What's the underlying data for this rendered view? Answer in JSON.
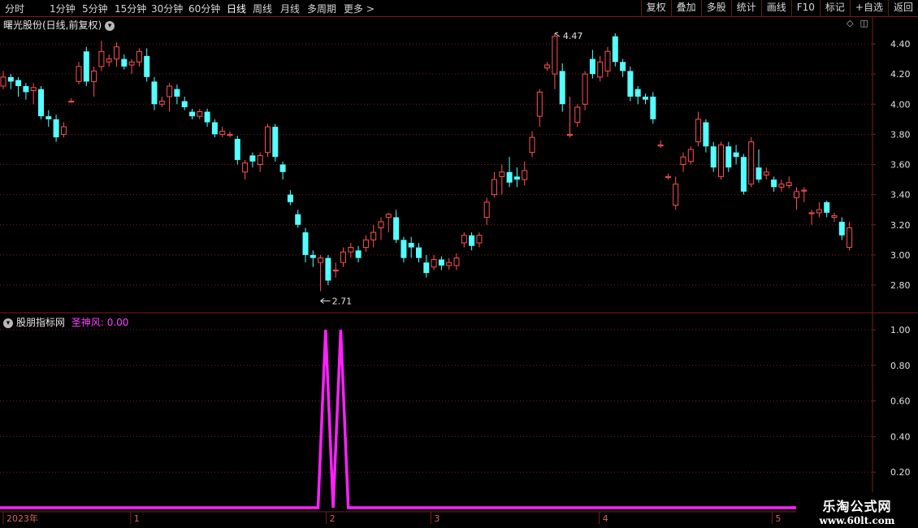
{
  "toolbar": {
    "periods": [
      "分时",
      "1分钟",
      "5分钟",
      "15分钟",
      "30分钟",
      "60分钟",
      "日线",
      "周线",
      "月线",
      "多周期",
      "更多 >"
    ],
    "active_period": "日线",
    "buttons": [
      "复权",
      "叠加",
      "多股",
      "统计",
      "画线",
      "F10",
      "标记",
      "+自选",
      "返回"
    ]
  },
  "main_panel": {
    "title": "曙光股份(日线,前复权)",
    "high_label": "4.47",
    "low_label": "2.71"
  },
  "indicator_panel": {
    "name": "股朋指标网",
    "series_label": "圣神风: 0.00"
  },
  "date_axis": [
    "2023年",
    "1",
    "2",
    "3",
    "4",
    "5"
  ],
  "watermark": {
    "line1": "乐淘公式网",
    "line2": "www.60lt.com"
  },
  "colors": {
    "up": "#ff5050",
    "down": "#54ffff",
    "indicator": "#ff20ff",
    "grid": "#7a1e1e"
  },
  "chart_data": [
    {
      "type": "candlestick",
      "title": "曙光股份(日线,前复权)",
      "ylim": [
        2.71,
        4.47
      ],
      "y_ticks": [
        4.4,
        4.2,
        4.0,
        3.8,
        3.6,
        3.4,
        3.2,
        3.0,
        2.8
      ],
      "candles": [
        [
          4.12,
          4.18,
          4.1,
          4.22
        ],
        [
          4.18,
          4.15,
          4.1,
          4.2
        ],
        [
          4.16,
          4.12,
          4.05,
          4.18
        ],
        [
          4.12,
          4.08,
          4.03,
          4.14
        ],
        [
          4.09,
          4.11,
          4.0,
          4.14
        ],
        [
          4.1,
          3.92,
          3.9,
          4.12
        ],
        [
          3.92,
          3.9,
          3.85,
          3.96
        ],
        [
          3.9,
          3.78,
          3.75,
          3.93
        ],
        [
          3.8,
          3.85,
          3.78,
          3.88
        ],
        [
          4.02,
          4.02,
          4.01,
          4.04
        ],
        [
          4.15,
          4.25,
          4.13,
          4.28
        ],
        [
          4.35,
          4.15,
          4.12,
          4.38
        ],
        [
          4.15,
          4.22,
          4.05,
          4.25
        ],
        [
          4.25,
          4.35,
          4.22,
          4.42
        ],
        [
          4.28,
          4.3,
          4.25,
          4.33
        ],
        [
          4.3,
          4.38,
          4.25,
          4.41
        ],
        [
          4.3,
          4.25,
          4.23,
          4.33
        ],
        [
          4.26,
          4.28,
          4.2,
          4.3
        ],
        [
          4.28,
          4.35,
          4.25,
          4.37
        ],
        [
          4.32,
          4.18,
          4.15,
          4.37
        ],
        [
          4.15,
          4.0,
          3.96,
          4.18
        ],
        [
          4.0,
          4.02,
          3.98,
          4.05
        ],
        [
          4.05,
          4.12,
          3.95,
          4.14
        ],
        [
          4.1,
          4.05,
          4.0,
          4.13
        ],
        [
          4.02,
          3.98,
          3.96,
          4.05
        ],
        [
          3.95,
          3.92,
          3.9,
          3.97
        ],
        [
          3.92,
          3.95,
          3.9,
          3.97
        ],
        [
          3.95,
          3.88,
          3.85,
          3.97
        ],
        [
          3.88,
          3.8,
          3.78,
          3.9
        ],
        [
          3.8,
          3.82,
          3.78,
          3.85
        ],
        [
          3.8,
          3.8,
          3.78,
          3.82
        ],
        [
          3.77,
          3.63,
          3.6,
          3.79
        ],
        [
          3.55,
          3.61,
          3.5,
          3.63
        ],
        [
          3.66,
          3.62,
          3.58,
          3.68
        ],
        [
          3.6,
          3.66,
          3.55,
          3.68
        ],
        [
          3.68,
          3.85,
          3.65,
          3.87
        ],
        [
          3.85,
          3.65,
          3.62,
          3.87
        ],
        [
          3.6,
          3.55,
          3.5,
          3.62
        ],
        [
          3.4,
          3.35,
          3.33,
          3.43
        ],
        [
          3.27,
          3.2,
          3.18,
          3.3
        ],
        [
          3.15,
          3.0,
          2.95,
          3.18
        ],
        [
          3.0,
          2.98,
          2.92,
          3.03
        ],
        [
          2.95,
          2.98,
          2.76,
          3.0
        ],
        [
          2.98,
          2.83,
          2.8,
          3.0
        ],
        [
          2.9,
          2.9,
          2.85,
          2.95
        ],
        [
          2.95,
          3.02,
          2.92,
          3.05
        ],
        [
          3.02,
          3.05,
          2.98,
          3.08
        ],
        [
          3.03,
          2.98,
          2.95,
          3.06
        ],
        [
          3.05,
          3.1,
          3.02,
          3.13
        ],
        [
          3.1,
          3.15,
          3.05,
          3.2
        ],
        [
          3.18,
          3.22,
          3.1,
          3.25
        ],
        [
          3.25,
          3.27,
          3.15,
          3.28
        ],
        [
          3.25,
          3.1,
          3.08,
          3.3
        ],
        [
          3.1,
          2.98,
          2.95,
          3.12
        ],
        [
          3.08,
          3.05,
          2.98,
          3.12
        ],
        [
          3.05,
          2.98,
          2.95,
          3.08
        ],
        [
          2.95,
          2.88,
          2.85,
          3.0
        ],
        [
          2.92,
          2.97,
          2.9,
          3.0
        ],
        [
          2.97,
          2.93,
          2.9,
          2.99
        ],
        [
          2.93,
          2.95,
          2.9,
          2.98
        ],
        [
          2.93,
          2.98,
          2.9,
          3.01
        ],
        [
          3.08,
          3.13,
          3.05,
          3.15
        ],
        [
          3.13,
          3.06,
          3.03,
          3.15
        ],
        [
          3.08,
          3.13,
          3.05,
          3.15
        ],
        [
          3.25,
          3.35,
          3.2,
          3.38
        ],
        [
          3.4,
          3.5,
          3.38,
          3.55
        ],
        [
          3.52,
          3.55,
          3.4,
          3.6
        ],
        [
          3.55,
          3.48,
          3.45,
          3.65
        ],
        [
          3.52,
          3.5,
          3.45,
          3.58
        ],
        [
          3.5,
          3.56,
          3.46,
          3.62
        ],
        [
          3.68,
          3.78,
          3.65,
          3.82
        ],
        [
          3.92,
          4.08,
          3.85,
          4.1
        ],
        [
          4.24,
          4.26,
          4.22,
          4.28
        ],
        [
          4.2,
          4.45,
          4.1,
          4.47
        ],
        [
          4.22,
          4.0,
          3.95,
          4.27
        ],
        [
          3.8,
          3.8,
          3.78,
          4.05
        ],
        [
          3.88,
          3.98,
          3.85,
          4.0
        ],
        [
          4.0,
          4.2,
          3.96,
          4.22
        ],
        [
          4.3,
          4.2,
          4.17,
          4.36
        ],
        [
          4.18,
          4.28,
          4.15,
          4.32
        ],
        [
          4.22,
          4.35,
          4.18,
          4.38
        ],
        [
          4.45,
          4.28,
          4.25,
          4.47
        ],
        [
          4.28,
          4.22,
          4.18,
          4.3
        ],
        [
          4.22,
          4.05,
          4.02,
          4.25
        ],
        [
          4.1,
          4.05,
          4.0,
          4.12
        ],
        [
          4.05,
          4.03,
          4.0,
          4.07
        ],
        [
          4.05,
          3.9,
          3.87,
          4.08
        ],
        [
          3.73,
          3.73,
          3.71,
          3.76
        ],
        [
          3.52,
          3.52,
          3.5,
          3.54
        ],
        [
          3.33,
          3.47,
          3.3,
          3.52
        ],
        [
          3.6,
          3.65,
          3.55,
          3.68
        ],
        [
          3.62,
          3.7,
          3.6,
          3.72
        ],
        [
          3.75,
          3.9,
          3.72,
          3.95
        ],
        [
          3.88,
          3.72,
          3.68,
          3.9
        ],
        [
          3.72,
          3.58,
          3.55,
          3.75
        ],
        [
          3.52,
          3.73,
          3.5,
          3.75
        ],
        [
          3.72,
          3.58,
          3.55,
          3.75
        ],
        [
          3.68,
          3.65,
          3.6,
          3.73
        ],
        [
          3.65,
          3.42,
          3.4,
          3.67
        ],
        [
          3.47,
          3.75,
          3.45,
          3.78
        ],
        [
          3.58,
          3.5,
          3.48,
          3.7
        ],
        [
          3.53,
          3.55,
          3.5,
          3.58
        ],
        [
          3.5,
          3.45,
          3.42,
          3.52
        ],
        [
          3.45,
          3.47,
          3.42,
          3.5
        ],
        [
          3.46,
          3.48,
          3.44,
          3.52
        ],
        [
          3.38,
          3.42,
          3.3,
          3.45
        ],
        [
          3.43,
          3.43,
          3.35,
          3.45
        ],
        [
          3.28,
          3.28,
          3.2,
          3.3
        ],
        [
          3.28,
          3.3,
          3.25,
          3.35
        ],
        [
          3.35,
          3.28,
          3.25,
          3.36
        ],
        [
          3.25,
          3.26,
          3.22,
          3.28
        ],
        [
          3.22,
          3.13,
          3.1,
          3.25
        ],
        [
          3.05,
          3.18,
          3.03,
          3.22
        ]
      ]
    },
    {
      "type": "line",
      "name": "圣神风",
      "ylim": [
        0,
        1
      ],
      "y_ticks": [
        1.0,
        0.8,
        0.6,
        0.4,
        0.2
      ],
      "values_nonzero": [
        [
          40,
          1.0
        ],
        [
          42,
          1.0
        ]
      ],
      "value_count": 116,
      "baseline": 0.0
    }
  ]
}
